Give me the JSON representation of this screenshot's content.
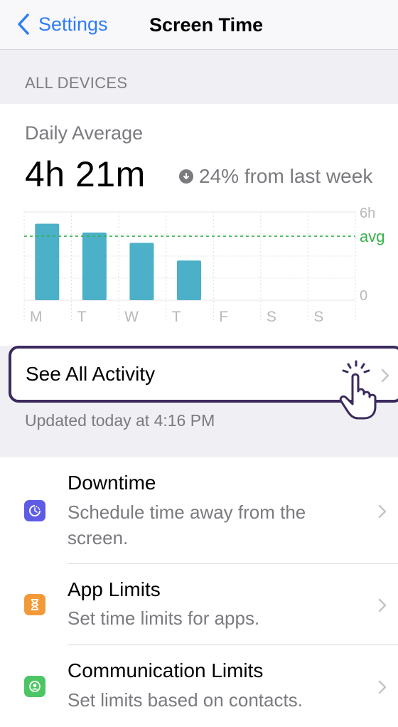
{
  "nav": {
    "back_label": "Settings",
    "title": "Screen Time"
  },
  "section_header": "ALL DEVICES",
  "summary": {
    "label": "Daily Average",
    "value": "4h 21m",
    "trend": "24% from last week",
    "trend_direction": "down"
  },
  "chart_data": {
    "type": "bar",
    "categories": [
      "M",
      "T",
      "W",
      "T",
      "F",
      "S",
      "S"
    ],
    "values": [
      5.2,
      4.6,
      3.9,
      2.7,
      0,
      0,
      0
    ],
    "ylim": [
      0,
      6
    ],
    "ytick_labels": [
      "6h",
      "0"
    ],
    "avg_label": "avg",
    "avg_value": 4.35,
    "bar_color": "#4bb0c8",
    "avg_line_color": "#36b24a",
    "grid": true
  },
  "see_all": {
    "label": "See All Activity"
  },
  "updated": "Updated today at 4:16 PM",
  "items": [
    {
      "title": "Downtime",
      "subtitle": "Schedule time away from the screen.",
      "icon": "downtime-icon",
      "color": "#5e5ce6"
    },
    {
      "title": "App Limits",
      "subtitle": "Set time limits for apps.",
      "icon": "hourglass-icon",
      "color": "#f29a38"
    },
    {
      "title": "Communication Limits",
      "subtitle": "Set limits based on contacts.",
      "icon": "contact-icon",
      "color": "#4cc664"
    }
  ],
  "colors": {
    "accent": "#2f7cf6",
    "highlight_border": "#3b2a5e",
    "secondary_text": "#7a7a7f"
  }
}
